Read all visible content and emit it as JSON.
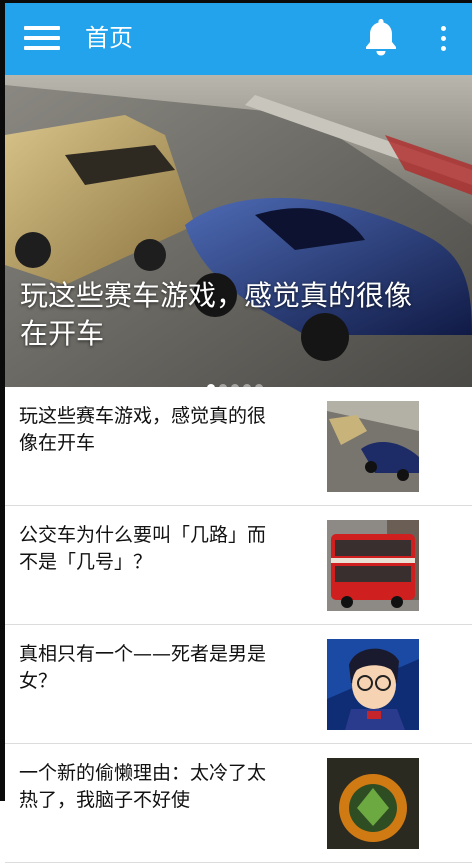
{
  "toolbar": {
    "title": "首页",
    "menu_icon": "hamburger-menu-icon",
    "notification_icon": "bell-icon",
    "overflow_icon": "more-vertical-icon"
  },
  "banner": {
    "title": "玩这些赛车游戏，感觉真的很像在开车",
    "indicator_count": 5,
    "active_index": 0
  },
  "articles": [
    {
      "title": "玩这些赛车游戏，感觉真的很像在开车",
      "thumbnail": "racing-cars"
    },
    {
      "title": "公交车为什么要叫「几路」而不是「几号」？",
      "thumbnail": "red-double-decker-bus"
    },
    {
      "title": "真相只有一个——死者是男是女？",
      "thumbnail": "cartoon-detective"
    },
    {
      "title": "一个新的偷懒理由：太冷了太热了，我脑子不好使",
      "thumbnail": "green-dial"
    }
  ],
  "colors": {
    "toolbar": "#23a3eb",
    "divider": "#dcdcdc"
  }
}
